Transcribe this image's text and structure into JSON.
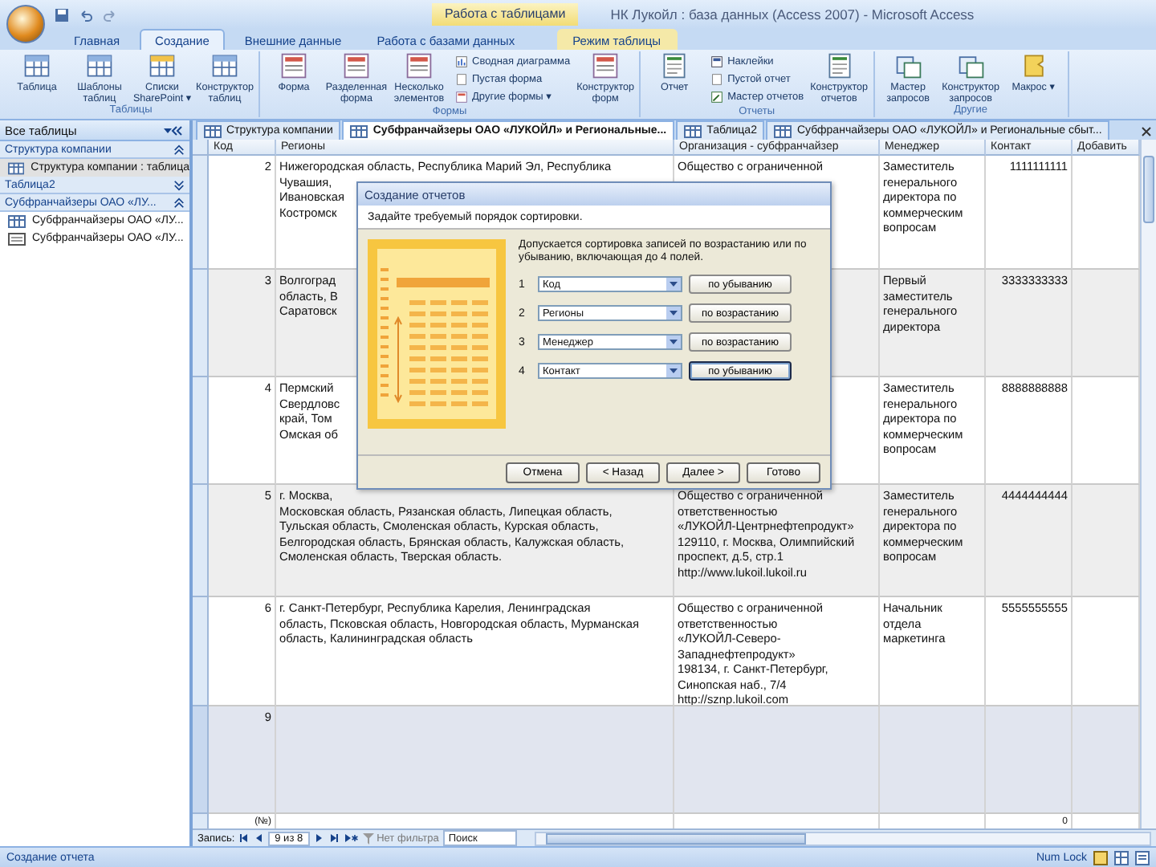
{
  "window": {
    "title": "НК Лукойл : база данных (Access 2007) - Microsoft Access",
    "context_caption": "Работа с таблицами"
  },
  "ribbon_tabs": [
    {
      "label": "Главная",
      "selected": false,
      "contextual": false
    },
    {
      "label": "Создание",
      "selected": true,
      "contextual": false
    },
    {
      "label": "Внешние данные",
      "selected": false,
      "contextual": false
    },
    {
      "label": "Работа с базами данных",
      "selected": false,
      "contextual": false
    },
    {
      "label": "Режим таблицы",
      "selected": false,
      "contextual": true
    }
  ],
  "ribbon_groups": [
    {
      "label": "Таблицы",
      "items": [
        {
          "kind": "large",
          "label": "Таблица"
        },
        {
          "kind": "large",
          "label": "Шаблоны таблиц"
        },
        {
          "kind": "large",
          "label": "Списки SharePoint ▾"
        },
        {
          "kind": "large",
          "label": "Конструктор таблиц"
        }
      ]
    },
    {
      "label": "Формы",
      "items": [
        {
          "kind": "large",
          "label": "Форма"
        },
        {
          "kind": "large",
          "label": "Разделенная форма"
        },
        {
          "kind": "large",
          "label": "Несколько элементов"
        },
        {
          "kind": "stack",
          "items": [
            {
              "label": "Сводная диаграмма"
            },
            {
              "label": "Пустая форма"
            },
            {
              "label": "Другие формы ▾"
            }
          ]
        },
        {
          "kind": "large",
          "label": "Конструктор форм"
        }
      ]
    },
    {
      "label": "Отчеты",
      "items": [
        {
          "kind": "large",
          "label": "Отчет"
        },
        {
          "kind": "stack",
          "items": [
            {
              "label": "Наклейки"
            },
            {
              "label": "Пустой отчет"
            },
            {
              "label": "Мастер отчетов"
            }
          ]
        },
        {
          "kind": "large",
          "label": "Конструктор отчетов"
        }
      ]
    },
    {
      "label": "Другие",
      "items": [
        {
          "kind": "large",
          "label": "Мастер запросов"
        },
        {
          "kind": "large",
          "label": "Конструктор запросов"
        },
        {
          "kind": "large",
          "label": "Макрос ▾"
        }
      ]
    }
  ],
  "nav_pane": {
    "title": "Все таблицы",
    "groups": [
      {
        "label": "Структура компании",
        "expanded": true,
        "items": [
          {
            "label": "Структура компании : таблица",
            "kind": "table",
            "selected": true
          }
        ]
      },
      {
        "label": "Таблица2",
        "expanded": false
      },
      {
        "label": "Субфранчайзеры ОАО «ЛУ...",
        "expanded": true,
        "items": [
          {
            "label": "Субфранчайзеры ОАО «ЛУ...",
            "kind": "table",
            "selected": false
          },
          {
            "label": "Субфранчайзеры ОАО «ЛУ...",
            "kind": "form",
            "selected": false
          }
        ]
      }
    ]
  },
  "document_tabs": [
    {
      "label": "Структура компании",
      "selected": false
    },
    {
      "label": "Субфранчайзеры ОАО «ЛУКОЙЛ» и Региональные...",
      "selected": true
    },
    {
      "label": "Таблица2",
      "selected": false
    },
    {
      "label": "Субфранчайзеры ОАО «ЛУКОЙЛ» и Региональные сбыт...",
      "selected": false
    }
  ],
  "table": {
    "columns": [
      "Код",
      "Регионы",
      "Организация - субфранчайзер",
      "Менеджер",
      "Контакт",
      "Добавить"
    ],
    "rows": [
      {
        "code": "2",
        "regions": [
          "Нижегородская область, Республика Марий Эл, Республика",
          "Чувашия,",
          "Ивановская",
          "Костромск"
        ],
        "org": [
          "Общество с ограниченной"
        ],
        "manager": [
          "Заместитель",
          "генерального",
          "директора по",
          "коммерческим",
          "вопросам"
        ],
        "contact": "1111111111",
        "shaded": false
      },
      {
        "code": "3",
        "regions": [
          "Волгоград",
          "область, В",
          "Саратовск"
        ],
        "org": [],
        "manager": [
          "Первый",
          "заместитель",
          "генерального",
          "директора"
        ],
        "contact": "3333333333",
        "shaded": true
      },
      {
        "code": "4",
        "regions": [
          "Пермский",
          "Свердловс",
          "край, Том",
          "Омская об"
        ],
        "org": [],
        "manager": [
          "Заместитель",
          "генерального",
          "директора по",
          "коммерческим",
          "вопросам"
        ],
        "contact": "8888888888",
        "shaded": false
      },
      {
        "code": "5",
        "regions": [
          "г. Москва,",
          "Московская область, Рязанская область, Липецкая область,",
          "Тульская область, Смоленская область, Курская область,",
          "Белгородская область, Брянская область, Калужская область,",
          "Смоленская область, Тверская область."
        ],
        "org": [
          "Общество с ограниченной",
          "ответственностью",
          "«ЛУКОЙЛ-Центрнефтепродукт»",
          "129110, г. Москва, Олимпийский",
          "проспект, д.5, стр.1",
          "http://www.lukoil.lukoil.ru"
        ],
        "manager": [
          "Заместитель",
          "генерального",
          "директора по",
          "коммерческим",
          "вопросам"
        ],
        "contact": "4444444444",
        "shaded": true
      },
      {
        "code": "6",
        "regions": [
          "г. Санкт-Петербург, Республика Карелия, Ленинградская",
          "область, Псковская область, Новгородская область, Мурманская",
          "область, Калининградская область"
        ],
        "org": [
          "Общество с ограниченной",
          "ответственностью",
          "«ЛУКОЙЛ-Северо-",
          "Западнефтепродукт»",
          "198134, г. Санкт-Петербург,",
          "Синопская наб., 7/4",
          "http://sznp.lukoil.com"
        ],
        "manager": [
          "Начальник",
          "отдела",
          "маркетинга"
        ],
        "contact": "5555555555",
        "shaded": false
      },
      {
        "code": "9",
        "regions": [],
        "org": [],
        "manager": [],
        "contact": "",
        "current": true
      }
    ],
    "new_row": {
      "code": "(№)",
      "contact": "0"
    }
  },
  "record_nav": {
    "label": "Запись:",
    "position": "9 из 8",
    "filter": "Нет фильтра",
    "search_placeholder": "Поиск"
  },
  "status_bar": {
    "left": "Создание отчета",
    "right": "Num Lock"
  },
  "dialog": {
    "title": "Создание отчетов",
    "instruction": "Задайте требуемый порядок сортировки.",
    "description": "Допускается сортировка записей по возрастанию или по убыванию, включающая до 4 полей.",
    "sorts": [
      {
        "number": "1",
        "field": "Код",
        "order": "по убыванию",
        "focused": false
      },
      {
        "number": "2",
        "field": "Регионы",
        "order": "по возрастанию",
        "focused": false
      },
      {
        "number": "3",
        "field": "Менеджер",
        "order": "по возрастанию",
        "focused": false
      },
      {
        "number": "4",
        "field": "Контакт",
        "order": "по убыванию",
        "focused": true
      }
    ],
    "buttons": [
      "Отмена",
      "< Назад",
      "Далее >",
      "Готово"
    ]
  }
}
